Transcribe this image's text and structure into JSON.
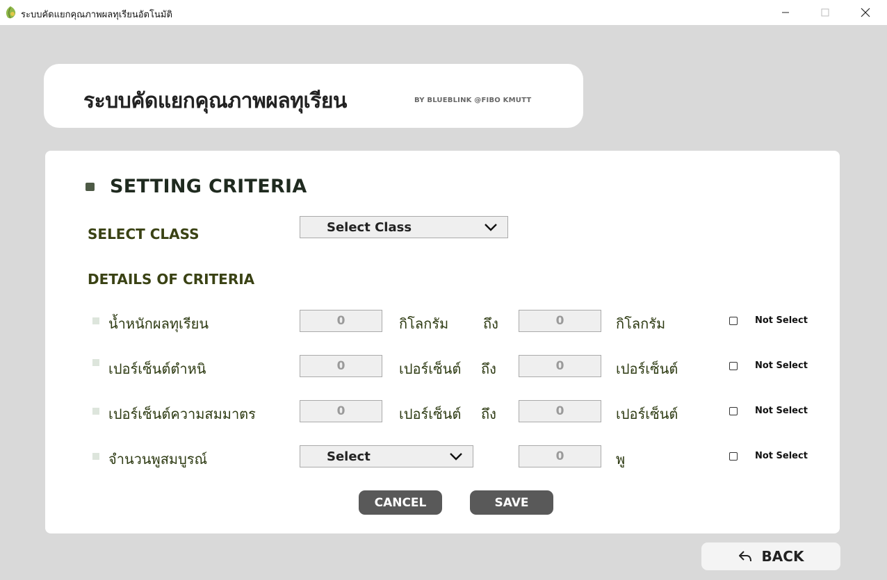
{
  "window": {
    "title": "ระบบคัดแยกคุณภาพผลทุเรียนอัตโนมัติ",
    "app_icon": "durian-leaf-icon"
  },
  "header": {
    "title": "ระบบคัดแยกคุณภาพผลทุเรียน",
    "subtitle": "BY BLUEBLINK @FIBO KMUTT"
  },
  "section": {
    "title": "SETTING CRITERIA",
    "select_class_label": "SELECT CLASS",
    "select_class_value": "Select Class",
    "details_label": "DETAILS OF CRITERIA"
  },
  "criteria": [
    {
      "label": "น้ำหนักผลทุเรียน",
      "min": "0",
      "unit_min": "กิโลกรัม",
      "to": "ถึง",
      "max": "0",
      "unit_max": "กิโลกรัม",
      "not_select": "Not Select"
    },
    {
      "label": "เปอร์เซ็นต์ตำหนิ",
      "min": "0",
      "unit_min": "เปอร์เซ็นต์",
      "to": "ถึง",
      "max": "0",
      "unit_max": "เปอร์เซ็นต์",
      "not_select": "Not Select"
    },
    {
      "label": "เปอร์เซ็นต์ความสมมาตร",
      "min": "0",
      "unit_min": "เปอร์เซ็นต์",
      "to": "ถึง",
      "max": "0",
      "unit_max": "เปอร์เซ็นต์",
      "not_select": "Not Select"
    },
    {
      "label": "จำนวนพูสมบูรณ์",
      "select_value": "Select",
      "max": "0",
      "unit_max": "พู",
      "not_select": "Not Select"
    }
  ],
  "buttons": {
    "cancel": "CANCEL",
    "save": "SAVE",
    "back": "BACK"
  },
  "colors": {
    "background": "#d9d9d9",
    "button": "#595959",
    "label_green": "#3a4214"
  }
}
